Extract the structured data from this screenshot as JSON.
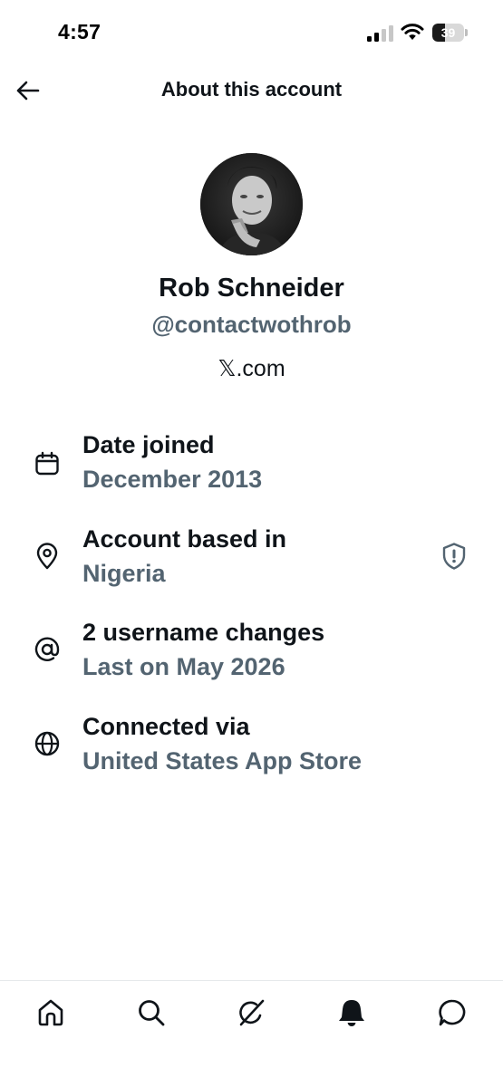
{
  "status_bar": {
    "time": "4:57",
    "battery_level": "39",
    "battery_fraction": 0.39
  },
  "header": {
    "title": "About this account",
    "back_icon": "arrow-left-icon"
  },
  "profile": {
    "name": "Rob Schneider",
    "handle": "@contactwothrob",
    "source": "𝕏.com"
  },
  "details": [
    {
      "icon": "calendar-icon",
      "label": "Date joined",
      "value": "December 2013"
    },
    {
      "icon": "location-pin-icon",
      "label": "Account based in",
      "value": "Nigeria",
      "badge_icon": "shield-alert-icon"
    },
    {
      "icon": "at-sign-icon",
      "label": "2 username changes",
      "value": "Last on May 2026"
    },
    {
      "icon": "globe-icon",
      "label": "Connected via",
      "value": "United States App Store"
    }
  ],
  "tabbar": {
    "items": [
      {
        "icon": "home-icon",
        "active": false
      },
      {
        "icon": "search-icon",
        "active": false
      },
      {
        "icon": "grok-icon",
        "active": false
      },
      {
        "icon": "bell-icon",
        "active": true
      },
      {
        "icon": "messages-icon",
        "active": false
      }
    ]
  },
  "colors": {
    "primary_text": "#0f1419",
    "secondary_text": "#536471",
    "background": "#ffffff",
    "divider": "#e6e9eb"
  }
}
